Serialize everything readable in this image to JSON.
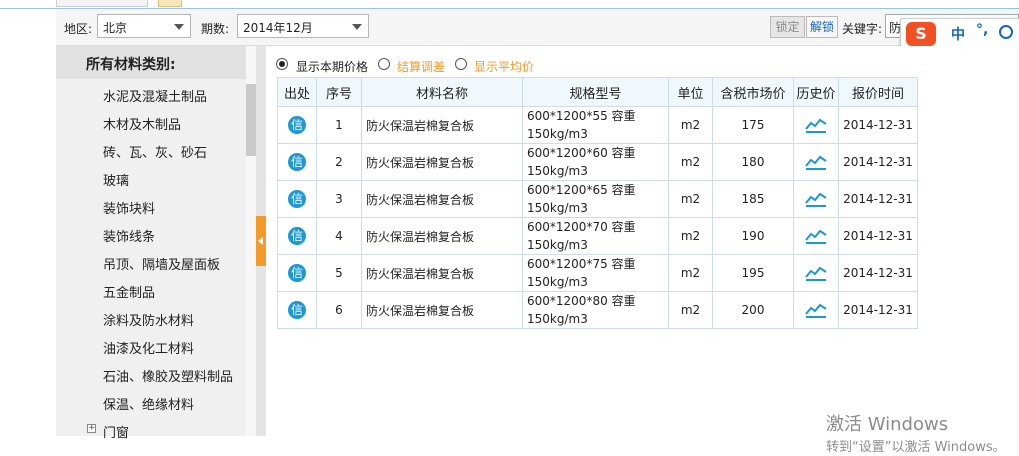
{
  "toolbar": {
    "region_label": "地区:",
    "region_value": "北京",
    "period_label": "期数:",
    "period_value": "2014年12月",
    "lock_label": "锁定",
    "unlock_label": "解锁",
    "keyword_label": "关键字:",
    "keyword_value": "防"
  },
  "ime": {
    "logo": "S",
    "mode": "中",
    "punct": "°,"
  },
  "sidebar": {
    "title": "所有材料类别:",
    "items": [
      {
        "label": "水泥及混凝土制品"
      },
      {
        "label": "木材及木制品"
      },
      {
        "label": "砖、瓦、灰、砂石"
      },
      {
        "label": "玻璃"
      },
      {
        "label": "装饰块料"
      },
      {
        "label": "装饰线条"
      },
      {
        "label": "吊顶、隔墙及屋面板"
      },
      {
        "label": "五金制品"
      },
      {
        "label": "涂料及防水材料"
      },
      {
        "label": "油漆及化工材料"
      },
      {
        "label": "石油、橡胶及塑料制品"
      },
      {
        "label": "保温、绝缘材料"
      },
      {
        "label": "门窗",
        "expand": "+"
      }
    ]
  },
  "options": {
    "opt1": "显示本期价格",
    "opt2": "结算调差",
    "opt3": "显示平均价",
    "selected": "opt1"
  },
  "table": {
    "headers": [
      "出处",
      "序号",
      "材料名称",
      "规格型号",
      "单位",
      "含税市场价",
      "历史价",
      "报价时间"
    ],
    "source_badge": "信",
    "rows": [
      {
        "no": "1",
        "name": "防火保温岩棉复合板",
        "spec": "600*1200*55 容重\n150kg/m3",
        "unit": "m2",
        "price": "175",
        "date": "2014-12-31"
      },
      {
        "no": "2",
        "name": "防火保温岩棉复合板",
        "spec": "600*1200*60 容重\n150kg/m3",
        "unit": "m2",
        "price": "180",
        "date": "2014-12-31"
      },
      {
        "no": "3",
        "name": "防火保温岩棉复合板",
        "spec": "600*1200*65 容重\n150kg/m3",
        "unit": "m2",
        "price": "185",
        "date": "2014-12-31"
      },
      {
        "no": "4",
        "name": "防火保温岩棉复合板",
        "spec": "600*1200*70 容重\n150kg/m3",
        "unit": "m2",
        "price": "190",
        "date": "2014-12-31"
      },
      {
        "no": "5",
        "name": "防火保温岩棉复合板",
        "spec": "600*1200*75 容重\n150kg/m3",
        "unit": "m2",
        "price": "195",
        "date": "2014-12-31"
      },
      {
        "no": "6",
        "name": "防火保温岩棉复合板",
        "spec": "600*1200*80 容重\n150kg/m3",
        "unit": "m2",
        "price": "200",
        "date": "2014-12-31"
      }
    ]
  },
  "watermark": {
    "line1": "激活 Windows",
    "line2": "转到“设置”以激活 Windows。"
  },
  "colors": {
    "accent_orange": "#f39a2b",
    "badge_blue": "#1e98d4",
    "link_blue": "#1565c0"
  }
}
